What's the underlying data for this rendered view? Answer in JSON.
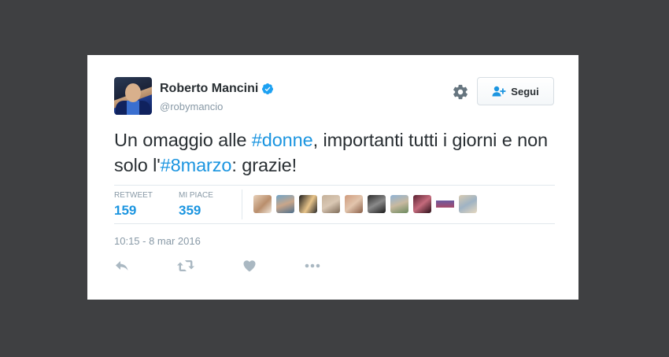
{
  "author": {
    "name": "Roberto Mancini",
    "handle": "@robymancio",
    "verified": true
  },
  "follow_button": {
    "label": "Segui"
  },
  "tweet": {
    "text_part1": "Un omaggio alle ",
    "hashtag1": "#donne",
    "text_part2": ", importanti tutti i giorni e non solo l'",
    "hashtag2": "#8marzo",
    "text_part3": ": grazie!"
  },
  "stats": {
    "retweet_label": "RETWEET",
    "retweet_count": "159",
    "like_label": "MI PIACE",
    "like_count": "359"
  },
  "timestamp": "10:15 - 8 mar 2016",
  "colors": {
    "accent": "#1b95e0",
    "background": "#3f4042",
    "text": "#292f33",
    "muted": "#8899a6"
  },
  "icons": [
    "verified-badge-icon",
    "gear-icon",
    "follow-person-icon",
    "reply-icon",
    "retweet-icon",
    "like-icon",
    "more-icon"
  ]
}
